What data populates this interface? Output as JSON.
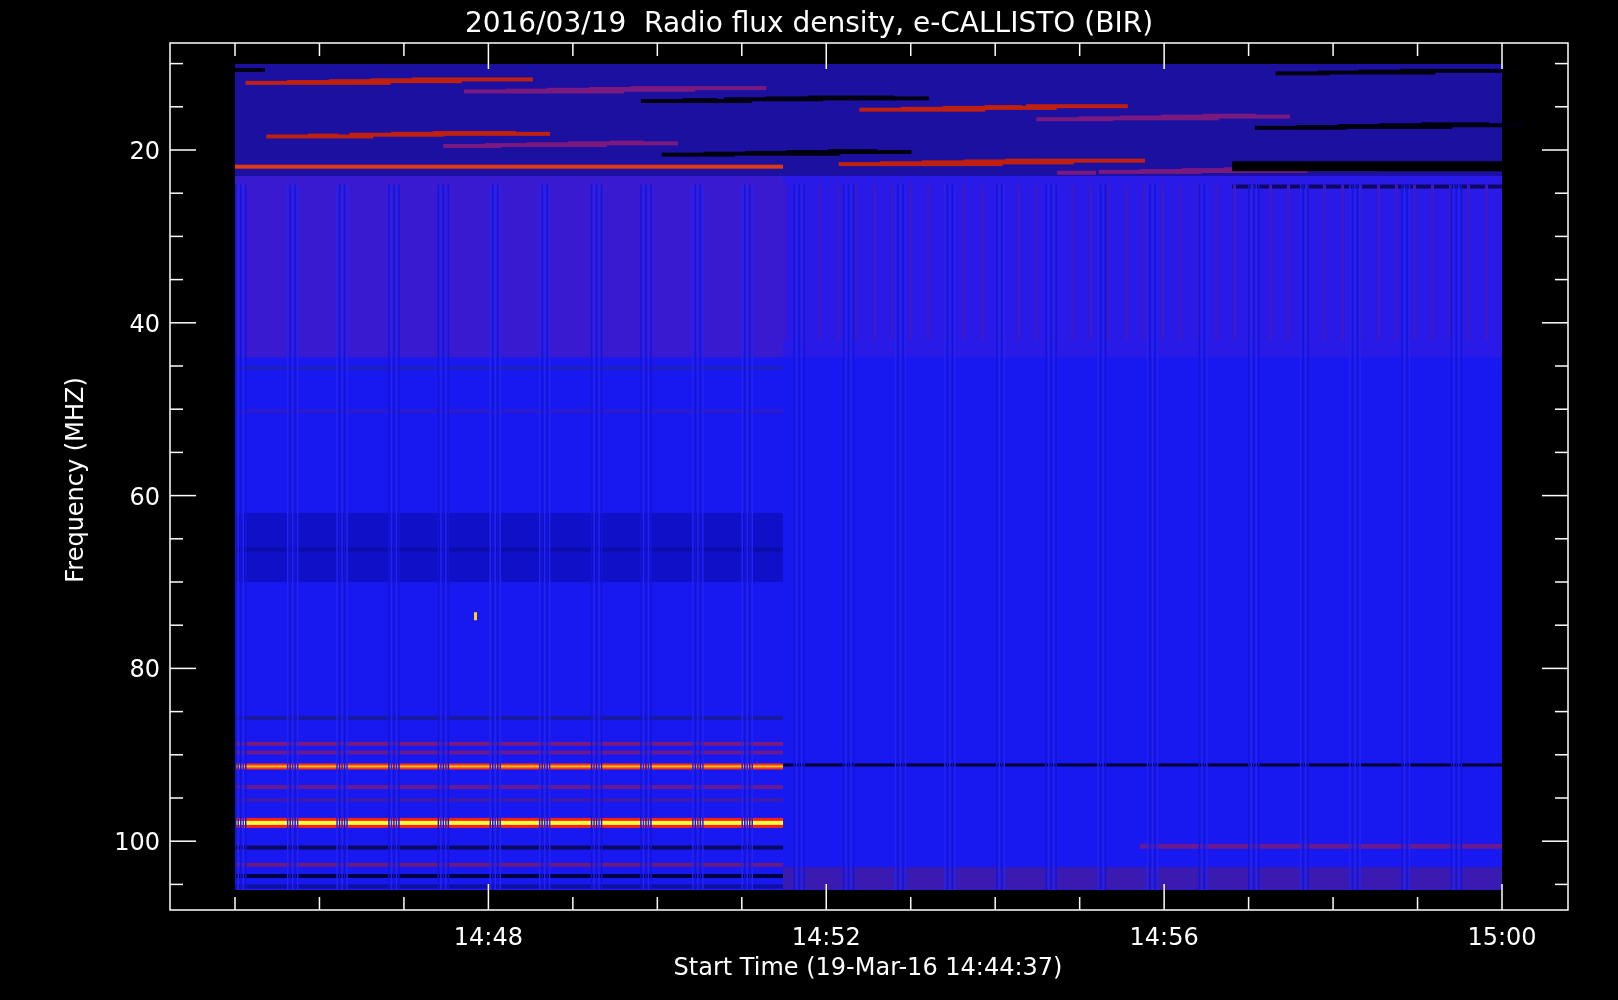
{
  "title": "2016/03/19  Radio flux density, e-CALLISTO (BIR)",
  "y_axis": {
    "label": "Frequency (MHZ)",
    "ticks": [
      "20",
      "40",
      "60",
      "80",
      "100"
    ]
  },
  "x_axis": {
    "label": "Start Time (19-Mar-16 14:44:37)",
    "ticks": [
      "14:48",
      "14:52",
      "14:56",
      "15:00"
    ]
  }
}
